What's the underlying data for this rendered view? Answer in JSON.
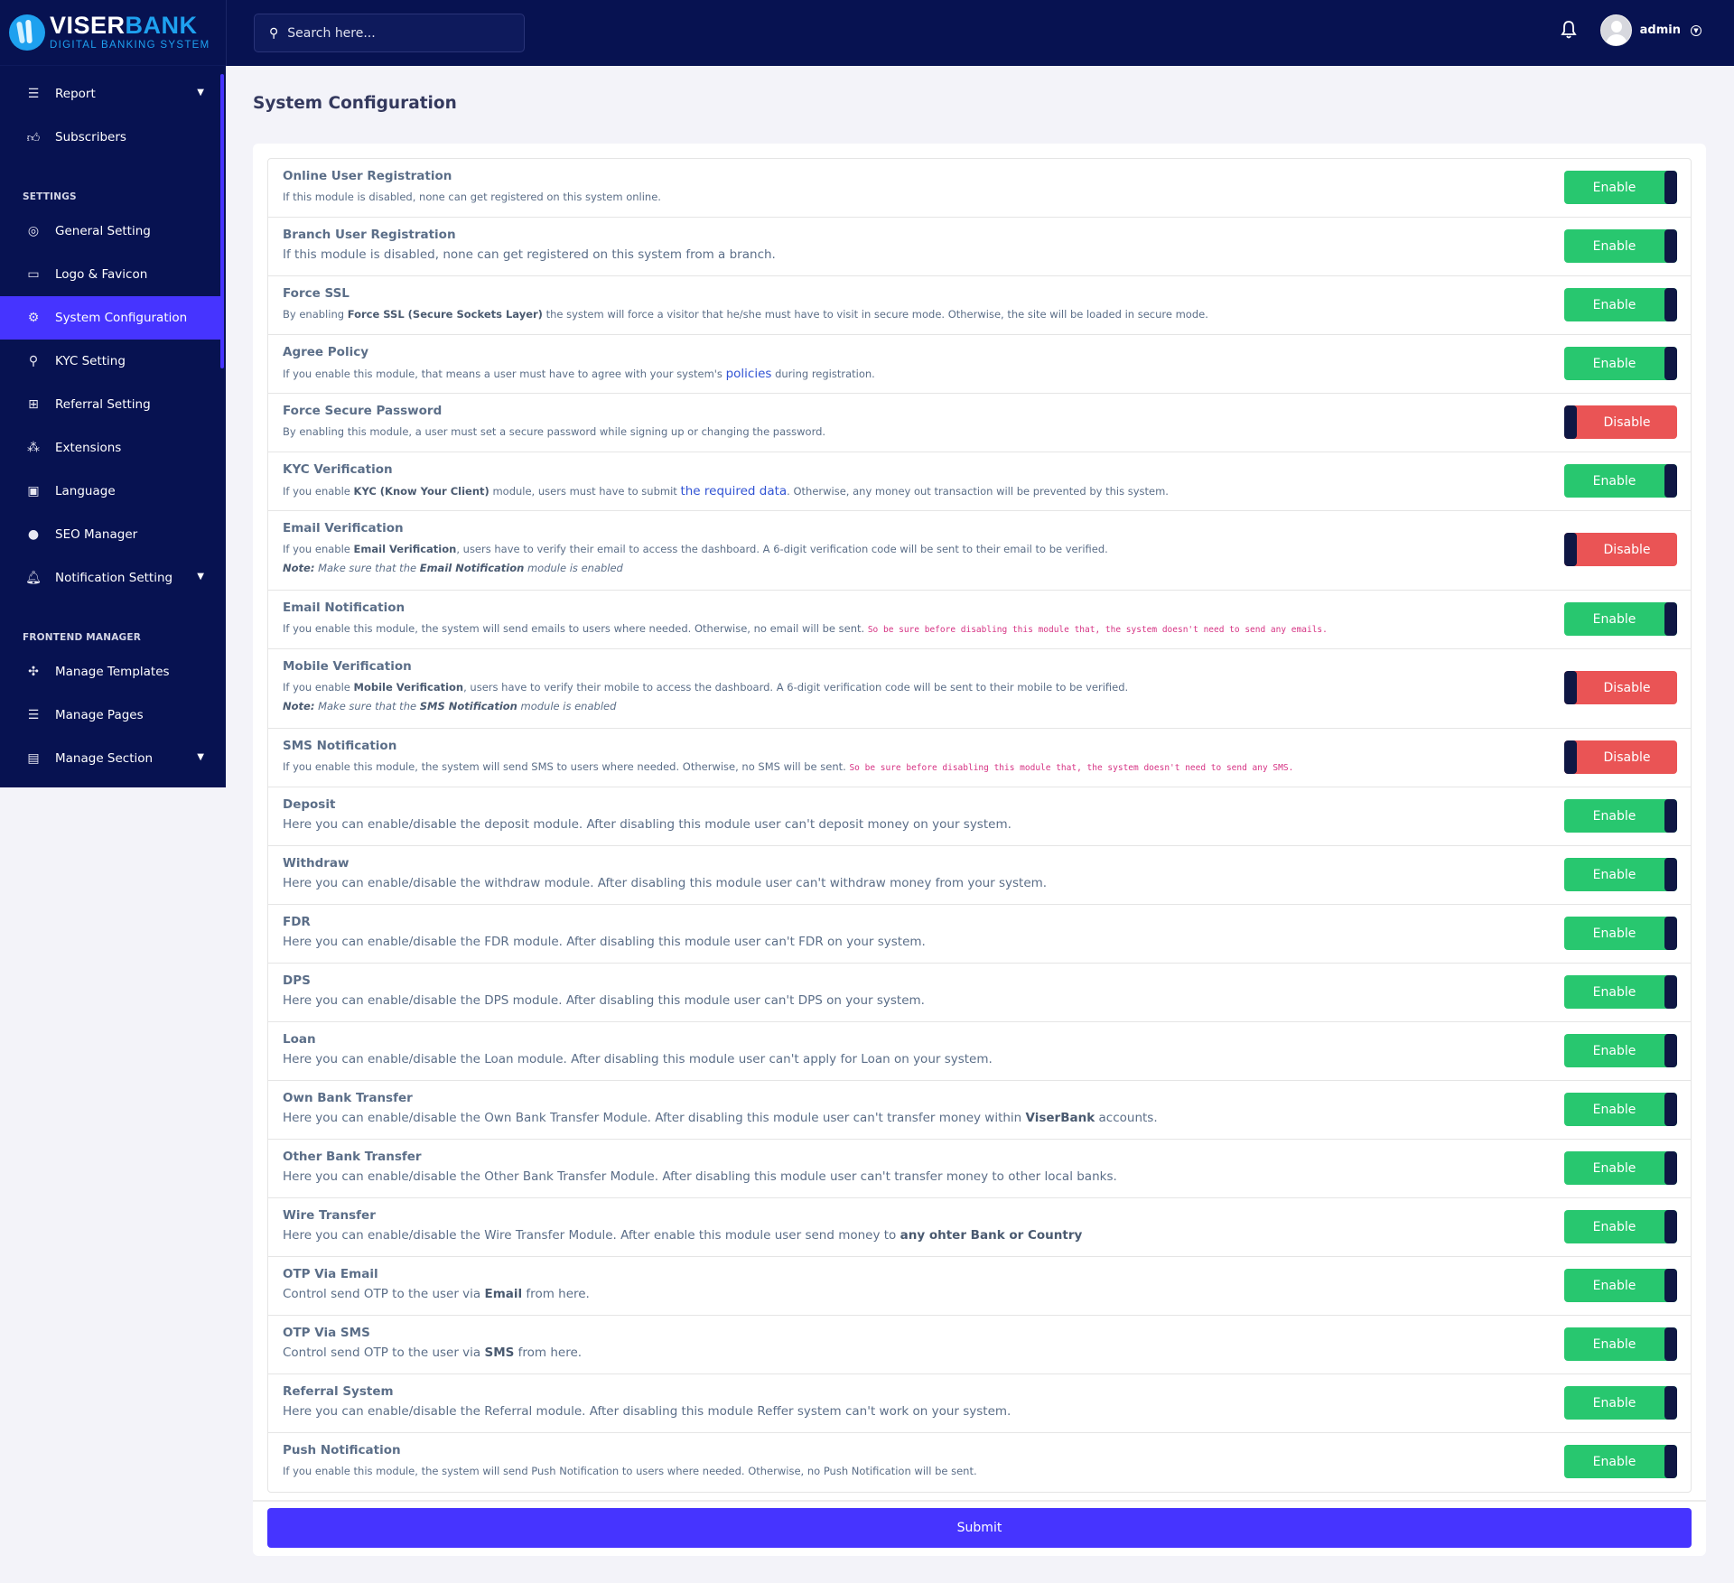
{
  "brand": {
    "name_part1": "VISER",
    "name_part2": "BANK",
    "tagline": "DIGITAL BANKING SYSTEM"
  },
  "header": {
    "search_placeholder": "Search here...",
    "user_name": "admin"
  },
  "colors": {
    "sidebar_bg": "#071251",
    "accent": "#4634ff",
    "enabled": "#28c76f",
    "disabled": "#ea5455",
    "knob": "#0f1744"
  },
  "sidebar": {
    "items_top": [
      {
        "label": "Report",
        "icon": "list-icon",
        "has_children": true
      },
      {
        "label": "Subscribers",
        "icon": "thumbs-up-icon",
        "has_children": false
      }
    ],
    "settings_heading": "SETTINGS",
    "settings_items": [
      {
        "label": "General Setting",
        "icon": "life-ring-icon"
      },
      {
        "label": "Logo & Favicon",
        "icon": "images-icon"
      },
      {
        "label": "System Configuration",
        "icon": "cog-icon",
        "active": true
      },
      {
        "label": "KYC Setting",
        "icon": "user-check-icon"
      },
      {
        "label": "Referral Setting",
        "icon": "sitemap-icon"
      },
      {
        "label": "Extensions",
        "icon": "cogs-icon"
      },
      {
        "label": "Language",
        "icon": "language-icon"
      },
      {
        "label": "SEO Manager",
        "icon": "globe-icon"
      },
      {
        "label": "Notification Setting",
        "icon": "bell-icon",
        "has_children": true
      }
    ],
    "frontend_heading": "FRONTEND MANAGER",
    "frontend_items": [
      {
        "label": "Manage Templates",
        "icon": "puzzle-icon"
      },
      {
        "label": "Manage Pages",
        "icon": "list-icon"
      },
      {
        "label": "Manage Section",
        "icon": "html5-icon",
        "has_children": true
      }
    ]
  },
  "page": {
    "title": "System Configuration",
    "submit_label": "Submit",
    "enable_label": "Enable",
    "disable_label": "Disable"
  },
  "modules": [
    {
      "title": "Online User Registration",
      "desc": "If this module is disabled, none can get registered on this system online.",
      "enabled": true
    },
    {
      "title": "Branch User Registration",
      "desc": "If this module is disabled, none can get registered on this system from a branch.",
      "enabled": true
    },
    {
      "title": "Force SSL",
      "desc_pre": "By enabling ",
      "desc_bold": "Force SSL (Secure Sockets Layer)",
      "desc_post": " the system will force a visitor that he/she must have to visit in secure mode. Otherwise, the site will be loaded in secure mode.",
      "enabled": true
    },
    {
      "title": "Agree Policy",
      "desc_pre": "If you enable this module, that means a user must have to agree with your system's ",
      "desc_link": "policies",
      "desc_post": " during registration.",
      "enabled": true
    },
    {
      "title": "Force Secure Password",
      "desc": "By enabling this module, a user must set a secure password while signing up or changing the password.",
      "enabled": false
    },
    {
      "title": "KYC Verification",
      "desc_pre": "If you enable ",
      "desc_bold": "KYC (Know Your Client)",
      "desc_mid": " module, users must have to submit ",
      "desc_link": "the required data",
      "desc_post": ". Otherwise, any money out transaction will be prevented by this system.",
      "enabled": true
    },
    {
      "title": "Email Verification",
      "desc_pre": "If you enable ",
      "desc_bold": "Email Verification",
      "desc_post": ", users have to verify their email to access the dashboard. A 6-digit verification code will be sent to their email to be verified.",
      "note_label": "Note:",
      "note_pre": " Make sure that the ",
      "note_bold": "Email Notification",
      "note_post": " module is enabled",
      "enabled": false
    },
    {
      "title": "Email Notification",
      "desc": "If you enable this module, the system will send emails to users where needed. Otherwise, no email will be sent. ",
      "desc_code": "So be sure before disabling this module that, the system doesn't need to send any emails.",
      "enabled": true
    },
    {
      "title": "Mobile Verification",
      "desc_pre": "If you enable ",
      "desc_bold": "Mobile Verification",
      "desc_post": ", users have to verify their mobile to access the dashboard. A 6-digit verification code will be sent to their mobile to be verified.",
      "note_label": "Note:",
      "note_pre": " Make sure that the ",
      "note_bold": "SMS Notification",
      "note_post": " module is enabled",
      "enabled": false
    },
    {
      "title": "SMS Notification",
      "desc": "If you enable this module, the system will send SMS to users where needed. Otherwise, no SMS will be sent. ",
      "desc_code": "So be sure before disabling this module that, the system doesn't need to send any SMS.",
      "enabled": false
    },
    {
      "title": "Deposit",
      "desc": "Here you can enable/disable the deposit module. After disabling this module user can't deposit money on your system.",
      "enabled": true
    },
    {
      "title": "Withdraw",
      "desc": "Here you can enable/disable the withdraw module. After disabling this module user can't withdraw money from your system.",
      "enabled": true
    },
    {
      "title": "FDR",
      "desc": "Here you can enable/disable the FDR module. After disabling this module user can't FDR on your system.",
      "enabled": true
    },
    {
      "title": "DPS",
      "desc": "Here you can enable/disable the DPS module. After disabling this module user can't DPS on your system.",
      "enabled": true
    },
    {
      "title": "Loan",
      "desc": "Here you can enable/disable the Loan module. After disabling this module user can't apply for Loan on your system.",
      "enabled": true
    },
    {
      "title": "Own Bank Transfer",
      "desc_pre": "Here you can enable/disable the Own Bank Transfer Module. After disabling this module user can't transfer money within ",
      "desc_bold": "ViserBank",
      "desc_post": " accounts.",
      "enabled": true
    },
    {
      "title": "Other Bank Transfer",
      "desc": "Here you can enable/disable the Other Bank Transfer Module. After disabling this module user can't transfer money to other local banks.",
      "enabled": true
    },
    {
      "title": "Wire Transfer",
      "desc_pre": "Here you can enable/disable the Wire Transfer Module. After enable this module user send money to ",
      "desc_bold": "any ohter Bank or Country",
      "desc_post": "",
      "enabled": true
    },
    {
      "title": "OTP Via Email",
      "desc_pre": "Control send OTP to the user via ",
      "desc_bold": "Email",
      "desc_post": " from here.",
      "enabled": true
    },
    {
      "title": "OTP Via SMS",
      "desc_pre": "Control send OTP to the user via ",
      "desc_bold": "SMS",
      "desc_post": " from here.",
      "enabled": true
    },
    {
      "title": "Referral System",
      "desc": "Here you can enable/disable the Referral module. After disabling this module Reffer system can't work on your system.",
      "enabled": true
    },
    {
      "title": "Push Notification",
      "desc": "If you enable this module, the system will send Push Notification to users where needed. Otherwise, no Push Notification will be sent.",
      "enabled": true
    }
  ]
}
